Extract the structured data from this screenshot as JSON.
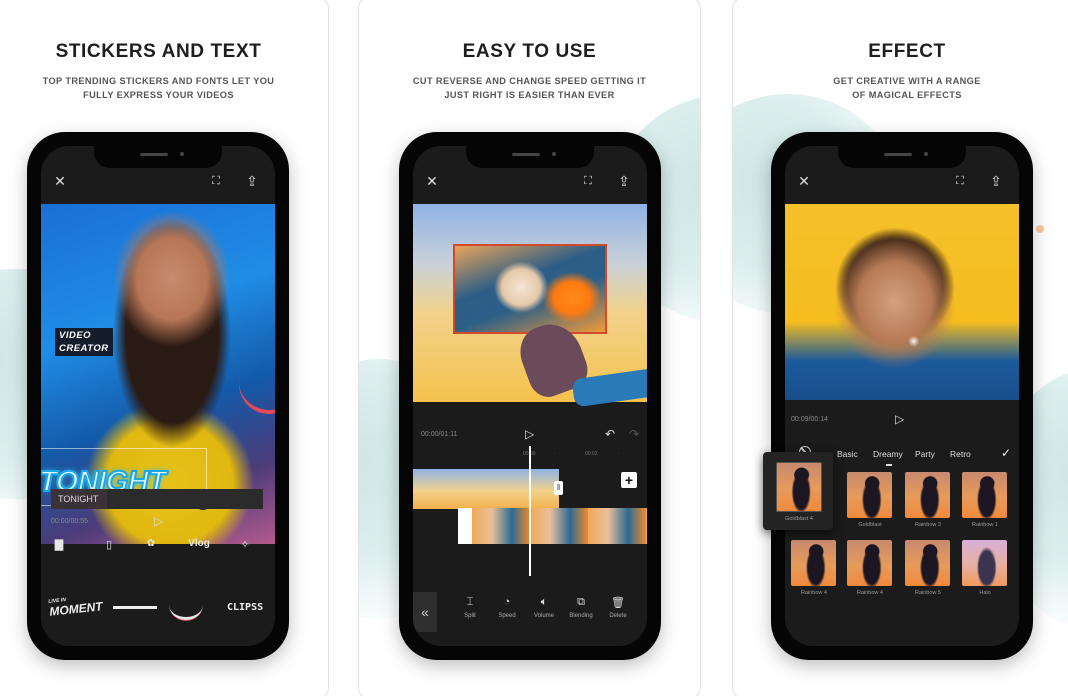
{
  "panels": [
    {
      "headline": "STICKERS AND TEXT",
      "subline_1": "TOP TRENDING STICKERS AND FONTS LET YOU",
      "subline_2": "FULLY EXPRESS YOUR VIDEOS",
      "phone": {
        "time": "00:00/00:55",
        "sticker_video": "VIDEO",
        "sticker_creator": "CREATOR",
        "sticker_tonight": "TONIGHT",
        "text_clip_label": "TONIGHT",
        "category_icons": [
          "text-template-icon",
          "phone-frame-icon",
          "sticker-emoji-icon",
          "Vlog",
          "sparkle-stickers-icon"
        ],
        "vlog_label": "Vlog",
        "sticker_row": {
          "moment": "MOMENT",
          "moment_small": "LIVE IN",
          "clipss": "CLIPSS"
        }
      }
    },
    {
      "headline": "EASY TO USE",
      "subline_1": "CUT REVERSE AND CHANGE SPEED GETTING IT",
      "subline_2": "JUST RIGHT IS EASIER THAN EVER",
      "phone": {
        "time": "00:00/01:11",
        "ruler_1": "00:00",
        "ruler_2": "00:02",
        "tools": [
          {
            "label": "Split",
            "icon": "split-icon"
          },
          {
            "label": "Speed",
            "icon": "speed-icon"
          },
          {
            "label": "Volume",
            "icon": "volume-icon"
          },
          {
            "label": "Blending",
            "icon": "blending-icon"
          },
          {
            "label": "Delete",
            "icon": "delete-icon"
          }
        ]
      }
    },
    {
      "headline": "EFFECT",
      "subline_1": "GET CREATIVE WITH A RANGE",
      "subline_2": "OF MAGICAL EFFECTS",
      "phone": {
        "time": "00:09/00:14",
        "tabs": [
          "Basic",
          "Dreamy",
          "Party",
          "Retro"
        ],
        "active_tab": "Dreamy",
        "effects_row_1": [
          "Goldblast 4",
          "Goldblast",
          "Rainbow 3",
          "Rainbow 1"
        ],
        "effects_row_2": [
          "Rainbow 4",
          "Rainbow 4",
          "Rainbow 5",
          "Halo"
        ]
      }
    }
  ]
}
